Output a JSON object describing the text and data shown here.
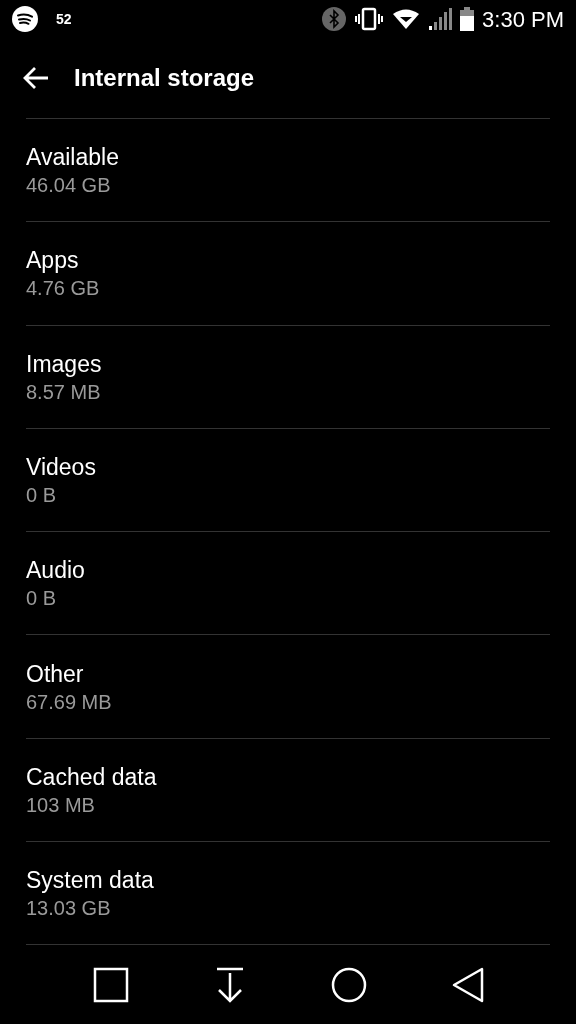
{
  "status_bar": {
    "notification_count": "52",
    "time": "3:30 PM"
  },
  "header": {
    "title": "Internal storage"
  },
  "items": [
    {
      "title": "Available",
      "value": "46.04 GB"
    },
    {
      "title": "Apps",
      "value": "4.76 GB"
    },
    {
      "title": "Images",
      "value": "8.57 MB"
    },
    {
      "title": "Videos",
      "value": "0 B"
    },
    {
      "title": "Audio",
      "value": "0 B"
    },
    {
      "title": "Other",
      "value": "67.69 MB"
    },
    {
      "title": "Cached data",
      "value": "103 MB"
    },
    {
      "title": "System data",
      "value": "13.03 GB"
    }
  ]
}
